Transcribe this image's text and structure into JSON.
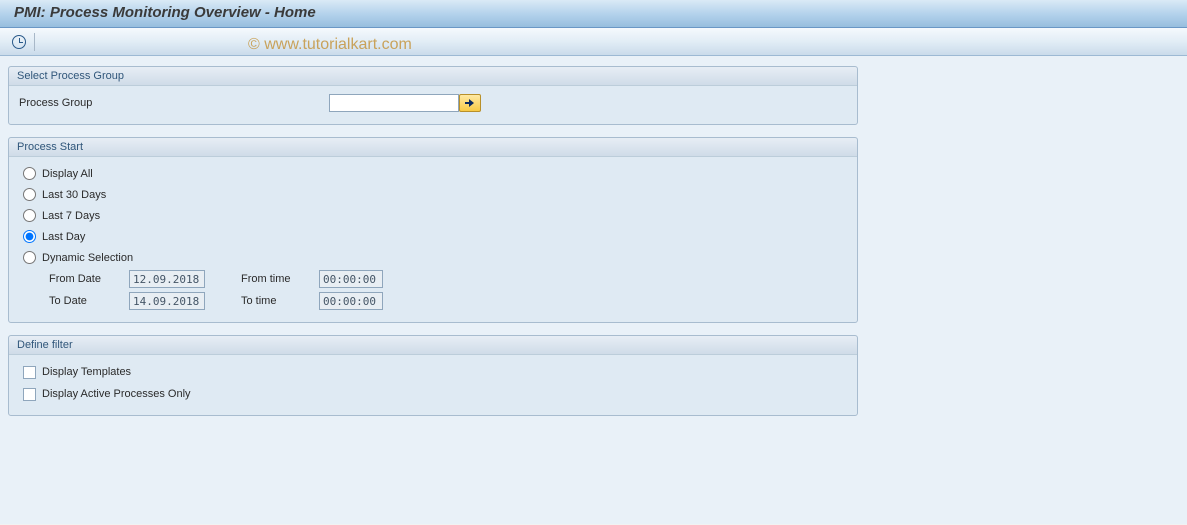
{
  "title": "PMI: Process Monitoring Overview - Home",
  "watermark": "© www.tutorialkart.com",
  "groups": {
    "select_process_group": {
      "title": "Select Process Group",
      "process_group_label": "Process Group",
      "process_group_value": ""
    },
    "process_start": {
      "title": "Process Start",
      "options": {
        "display_all": "Display All",
        "last_30": "Last 30 Days",
        "last_7": "Last 7 Days",
        "last_day": "Last Day",
        "dynamic": "Dynamic Selection"
      },
      "selected": "last_day",
      "from_date_label": "From Date",
      "from_date_value": "12.09.2018",
      "to_date_label": "To Date",
      "to_date_value": "14.09.2018",
      "from_time_label": "From time",
      "from_time_value": "00:00:00",
      "to_time_label": "To time",
      "to_time_value": "00:00:00"
    },
    "define_filter": {
      "title": "Define filter",
      "display_templates": "Display Templates",
      "display_active_only": "Display Active Processes Only"
    }
  }
}
